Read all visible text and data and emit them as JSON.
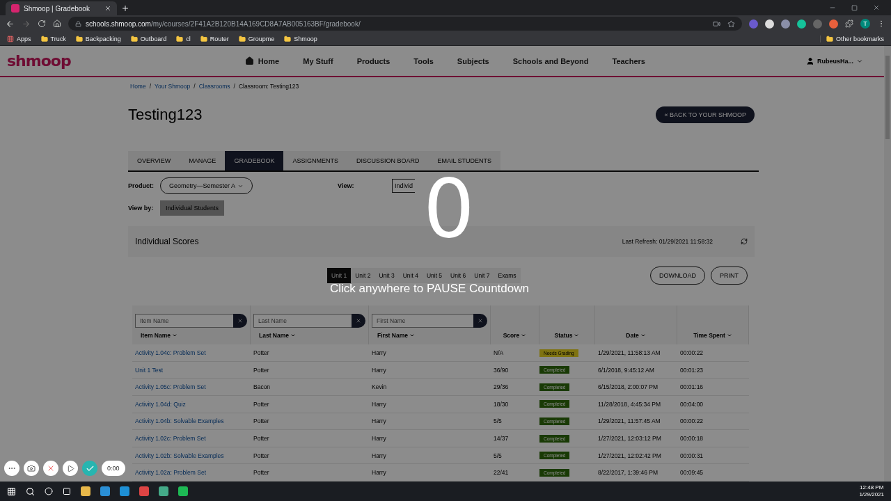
{
  "browser": {
    "tabs": [
      {
        "title": "Shmoop | Gradebook",
        "selected": true
      }
    ],
    "url": {
      "host": "schools.shmoop.com",
      "path": "/my/courses/2F41A2B120B14A169CD8A7AB005163BF/gradebook/"
    },
    "bookmarks": [
      {
        "label": "Apps",
        "kind": "apps"
      },
      {
        "label": "Truck",
        "kind": "folder"
      },
      {
        "label": "Backpacking",
        "kind": "folder"
      },
      {
        "label": "Outboard",
        "kind": "folder"
      },
      {
        "label": "cl",
        "kind": "folder"
      },
      {
        "label": "Router",
        "kind": "folder"
      },
      {
        "label": "Groupme",
        "kind": "folder"
      },
      {
        "label": "Shmoop",
        "kind": "folder"
      }
    ],
    "other_bookmarks": "Other bookmarks",
    "profile_initial": "T"
  },
  "site": {
    "logo": "shmoop",
    "nav": [
      {
        "label": "Home",
        "kind": "home"
      },
      {
        "label": "My Stuff",
        "kind": "link"
      },
      {
        "label": "Products",
        "kind": "link"
      },
      {
        "label": "Tools",
        "kind": "link"
      },
      {
        "label": "Subjects",
        "kind": "link"
      },
      {
        "label": "Schools and Beyond",
        "kind": "link"
      },
      {
        "label": "Teachers",
        "kind": "link"
      }
    ],
    "user": "RubeusHa..."
  },
  "breadcrumbs": [
    {
      "label": "Home",
      "link": true
    },
    {
      "label": "Your Shmoop",
      "link": true
    },
    {
      "label": "Classrooms",
      "link": true
    },
    {
      "label": "Classroom: Testing123",
      "link": false
    }
  ],
  "breadcrumb_separator": "/",
  "title": "Testing123",
  "back_button": "« BACK TO YOUR SHMOOP",
  "page_tabs": [
    {
      "label": "OVERVIEW",
      "selected": false
    },
    {
      "label": "MANAGE",
      "selected": false
    },
    {
      "label": "GRADEBOOK",
      "selected": true
    },
    {
      "label": "ASSIGNMENTS",
      "selected": false
    },
    {
      "label": "DISCUSSION BOARD",
      "selected": false
    },
    {
      "label": "EMAIL STUDENTS",
      "selected": false
    }
  ],
  "product": {
    "label": "Product:",
    "value": "Geometry—Semester A"
  },
  "view": {
    "label": "View:",
    "value": "Individ"
  },
  "view_by": {
    "label": "View by:",
    "value": "Individual Students"
  },
  "scores": {
    "title": "Individual Scores",
    "last_refresh": "Last Refresh: 01/29/2021 11:58:32",
    "unit_tabs": [
      {
        "label": "Unit 1",
        "selected": true
      },
      {
        "label": "Unit 2",
        "selected": false
      },
      {
        "label": "Unit 3",
        "selected": false
      },
      {
        "label": "Unit 4",
        "selected": false
      },
      {
        "label": "Unit 5",
        "selected": false
      },
      {
        "label": "Unit 6",
        "selected": false
      },
      {
        "label": "Unit 7",
        "selected": false
      },
      {
        "label": "Exams",
        "selected": false
      }
    ],
    "buttons": [
      "DOWNLOAD",
      "PRINT"
    ],
    "filters": [
      {
        "placeholder": "Item Name"
      },
      {
        "placeholder": "Last Name"
      },
      {
        "placeholder": "First Name"
      }
    ],
    "columns": [
      "Item Name",
      "Last Name",
      "First Name",
      "Score",
      "Status",
      "Date",
      "Time Spent"
    ],
    "rows": [
      {
        "item": "Activity 1.04c: Problem Set",
        "last": "Potter",
        "first": "Harry",
        "score": "N/A",
        "status": {
          "label": "Needs Grading",
          "kind": "pending"
        },
        "date": "1/29/2021, 11:58:13 AM",
        "time": "00:00:22"
      },
      {
        "item": "Unit 1 Test",
        "last": "Potter",
        "first": "Harry",
        "score": "36/90",
        "status": {
          "label": "Completed",
          "kind": "done"
        },
        "date": "6/1/2018, 9:45:12 AM",
        "time": "00:01:23"
      },
      {
        "item": "Activity 1.05c: Problem Set",
        "last": "Bacon",
        "first": "Kevin",
        "score": "29/36",
        "status": {
          "label": "Completed",
          "kind": "done"
        },
        "date": "6/15/2018, 2:00:07 PM",
        "time": "00:01:16"
      },
      {
        "item": "Activity 1.04d: Quiz",
        "last": "Potter",
        "first": "Harry",
        "score": "18/30",
        "status": {
          "label": "Completed",
          "kind": "done"
        },
        "date": "11/28/2018, 4:45:34 PM",
        "time": "00:04:00"
      },
      {
        "item": "Activity 1.04b: Solvable Examples",
        "last": "Potter",
        "first": "Harry",
        "score": "5/5",
        "status": {
          "label": "Completed",
          "kind": "done"
        },
        "date": "1/29/2021, 11:57:45 AM",
        "time": "00:00:22"
      },
      {
        "item": "Activity 1.02c: Problem Set",
        "last": "Potter",
        "first": "Harry",
        "score": "14/37",
        "status": {
          "label": "Completed",
          "kind": "done"
        },
        "date": "1/27/2021, 12:03:12 PM",
        "time": "00:00:18"
      },
      {
        "item": "Activity 1.02b: Solvable Examples",
        "last": "Potter",
        "first": "Harry",
        "score": "5/5",
        "status": {
          "label": "Completed",
          "kind": "done"
        },
        "date": "1/27/2021, 12:02:42 PM",
        "time": "00:00:31"
      },
      {
        "item": "Activity 1.02a: Problem Set",
        "last": "Potter",
        "first": "Harry",
        "score": "22/41",
        "status": {
          "label": "Completed",
          "kind": "done"
        },
        "date": "8/22/2017, 1:39:46 PM",
        "time": "00:09:45"
      }
    ]
  },
  "countdown": {
    "number": "0",
    "message": "Click anywhere to PAUSE Countdown"
  },
  "recorder": {
    "timer": "0:00"
  },
  "taskbar": {
    "time": "12:48 PM",
    "date": "1/29/2021"
  }
}
